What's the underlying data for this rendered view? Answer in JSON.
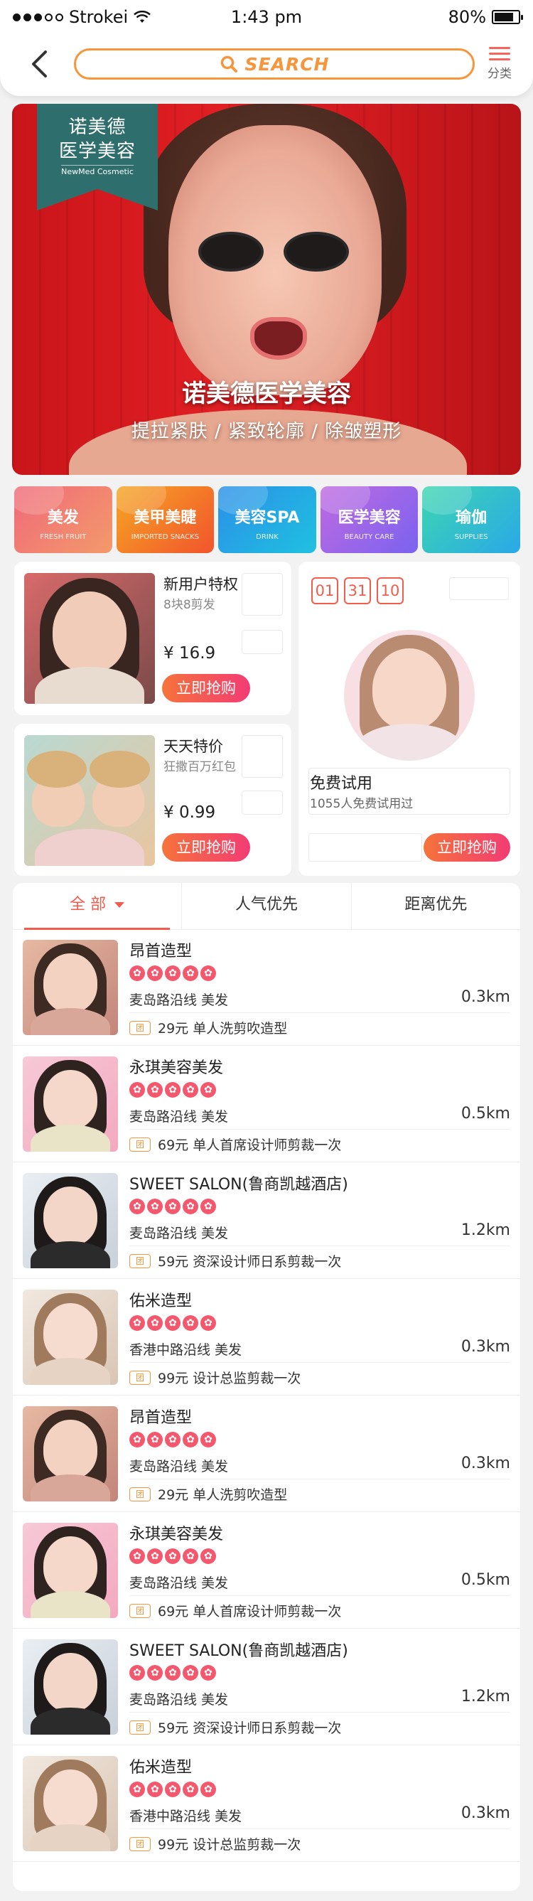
{
  "status": {
    "carrier": "Strokei",
    "time": "1:43 pm",
    "battery": "80%"
  },
  "nav": {
    "search_label": "SEARCH",
    "category_label": "分类"
  },
  "banner": {
    "logo_line1": "诺美德",
    "logo_line2": "医学美容",
    "logo_en": "NewMed Cosmetic",
    "title": "诺美德医学美容",
    "subtitle": "提拉紧肤 / 紧致轮廓 / 除皱塑形"
  },
  "categories": [
    {
      "name": "美发",
      "sub": "FRESH FRUIT",
      "colors": [
        "#f06a7a",
        "#f39a6a"
      ]
    },
    {
      "name": "美甲美睫",
      "sub": "IMPORTED SNACKS",
      "colors": [
        "#f5a623",
        "#f2542d"
      ]
    },
    {
      "name": "美容SPA",
      "sub": "DRINK",
      "colors": [
        "#2b8fe8",
        "#1fc1e0"
      ]
    },
    {
      "name": "医学美容",
      "sub": "BEAUTY CARE",
      "colors": [
        "#c06ae0",
        "#7a63f0"
      ]
    },
    {
      "name": "瑜伽",
      "sub": "SUPPLIES",
      "colors": [
        "#3dd6b0",
        "#2aa8e8"
      ]
    }
  ],
  "promos": {
    "new_user": {
      "title": "新用户特权",
      "sub": "8块8剪发",
      "price": "¥ 16.9",
      "button": "立即抢购"
    },
    "daily": {
      "title": "天天特价",
      "sub": "狂撒百万红包",
      "price": "¥ 0.99",
      "button": "立即抢购"
    },
    "trial": {
      "timer": [
        "01",
        "31",
        "10"
      ],
      "title": "免费试用",
      "sub": "1055人免费试用过",
      "button": "立即抢购"
    }
  },
  "tabs": [
    "全 部",
    "人气优先",
    "距离优先"
  ],
  "salons": [
    {
      "name": "昂首造型",
      "location": "麦岛路沿线  美发",
      "distance": "0.3km",
      "deal": "29元 单人洗剪吹造型",
      "tuan": "团",
      "rating": 5
    },
    {
      "name": "永琪美容美发",
      "location": "麦岛路沿线  美发",
      "distance": "0.5km",
      "deal": "69元 单人首席设计师剪裁一次",
      "tuan": "团",
      "rating": 5
    },
    {
      "name": "SWEET SALON(鲁商凯越酒店)",
      "location": "麦岛路沿线  美发",
      "distance": "1.2km",
      "deal": "59元 资深设计师日系剪裁一次",
      "tuan": "团",
      "rating": 5
    },
    {
      "name": "佑米造型",
      "location": "香港中路沿线 美发",
      "distance": "0.3km",
      "deal": "99元 设计总监剪裁一次",
      "tuan": "团",
      "rating": 5
    },
    {
      "name": "昂首造型",
      "location": "麦岛路沿线  美发",
      "distance": "0.3km",
      "deal": "29元 单人洗剪吹造型",
      "tuan": "团",
      "rating": 5
    },
    {
      "name": "永琪美容美发",
      "location": "麦岛路沿线  美发",
      "distance": "0.5km",
      "deal": "69元 单人首席设计师剪裁一次",
      "tuan": "团",
      "rating": 5
    },
    {
      "name": "SWEET SALON(鲁商凯越酒店)",
      "location": "麦岛路沿线  美发",
      "distance": "1.2km",
      "deal": "59元 资深设计师日系剪裁一次",
      "tuan": "团",
      "rating": 5
    },
    {
      "name": "佑米造型",
      "location": "香港中路沿线 美发",
      "distance": "0.3km",
      "deal": "99元 设计总监剪裁一次",
      "tuan": "团",
      "rating": 5
    }
  ]
}
